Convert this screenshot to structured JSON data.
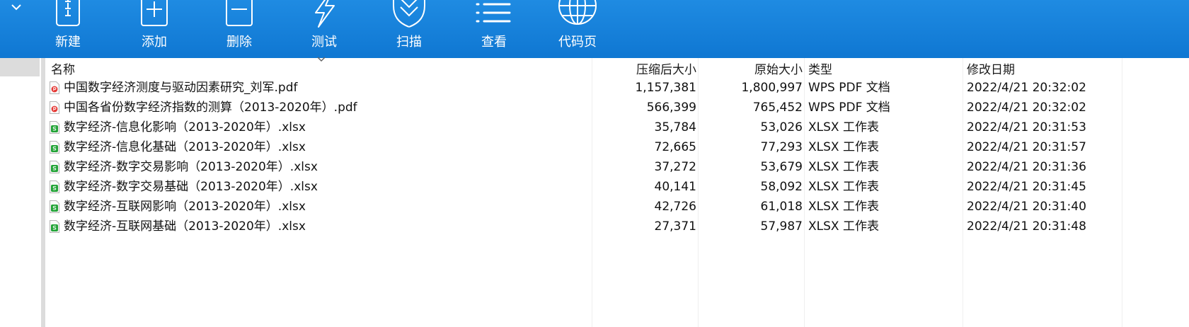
{
  "toolbar": {
    "buttons": [
      {
        "label": "新建",
        "icon": "new-archive-icon"
      },
      {
        "label": "添加",
        "icon": "add-icon"
      },
      {
        "label": "删除",
        "icon": "delete-icon"
      },
      {
        "label": "测试",
        "icon": "test-icon"
      },
      {
        "label": "扫描",
        "icon": "scan-shield-icon"
      },
      {
        "label": "查看",
        "icon": "view-list-icon"
      },
      {
        "label": "代码页",
        "icon": "codepage-globe-icon"
      }
    ]
  },
  "columns": {
    "name": "名称",
    "compressed": "压缩后大小",
    "original": "原始大小",
    "type": "类型",
    "modified": "修改日期"
  },
  "colors": {
    "toolbar": "#1383dc",
    "pdf_icon": "#e53935",
    "xlsx_icon": "#21a336"
  },
  "files": [
    {
      "name": "中国数字经济测度与驱动因素研究_刘军.pdf",
      "compressed": "1,157,381",
      "original": "1,800,997",
      "type": "WPS PDF 文档",
      "modified": "2022/4/21 20:32:02",
      "icon": "pdf-file-icon"
    },
    {
      "name": "中国各省份数字经济指数的测算（2013-2020年）.pdf",
      "compressed": "566,399",
      "original": "765,452",
      "type": "WPS PDF 文档",
      "modified": "2022/4/21 20:32:02",
      "icon": "pdf-file-icon"
    },
    {
      "name": "数字经济-信息化影响（2013-2020年）.xlsx",
      "compressed": "35,784",
      "original": "53,026",
      "type": "XLSX 工作表",
      "modified": "2022/4/21 20:31:53",
      "icon": "xlsx-file-icon"
    },
    {
      "name": "数字经济-信息化基础（2013-2020年）.xlsx",
      "compressed": "72,665",
      "original": "77,293",
      "type": "XLSX 工作表",
      "modified": "2022/4/21 20:31:57",
      "icon": "xlsx-file-icon"
    },
    {
      "name": "数字经济-数字交易影响（2013-2020年）.xlsx",
      "compressed": "37,272",
      "original": "53,679",
      "type": "XLSX 工作表",
      "modified": "2022/4/21 20:31:36",
      "icon": "xlsx-file-icon"
    },
    {
      "name": "数字经济-数字交易基础（2013-2020年）.xlsx",
      "compressed": "40,141",
      "original": "58,092",
      "type": "XLSX 工作表",
      "modified": "2022/4/21 20:31:45",
      "icon": "xlsx-file-icon"
    },
    {
      "name": "数字经济-互联网影响（2013-2020年）.xlsx",
      "compressed": "42,726",
      "original": "61,018",
      "type": "XLSX 工作表",
      "modified": "2022/4/21 20:31:40",
      "icon": "xlsx-file-icon"
    },
    {
      "name": "数字经济-互联网基础（2013-2020年）.xlsx",
      "compressed": "27,371",
      "original": "57,987",
      "type": "XLSX 工作表",
      "modified": "2022/4/21 20:31:48",
      "icon": "xlsx-file-icon"
    }
  ]
}
